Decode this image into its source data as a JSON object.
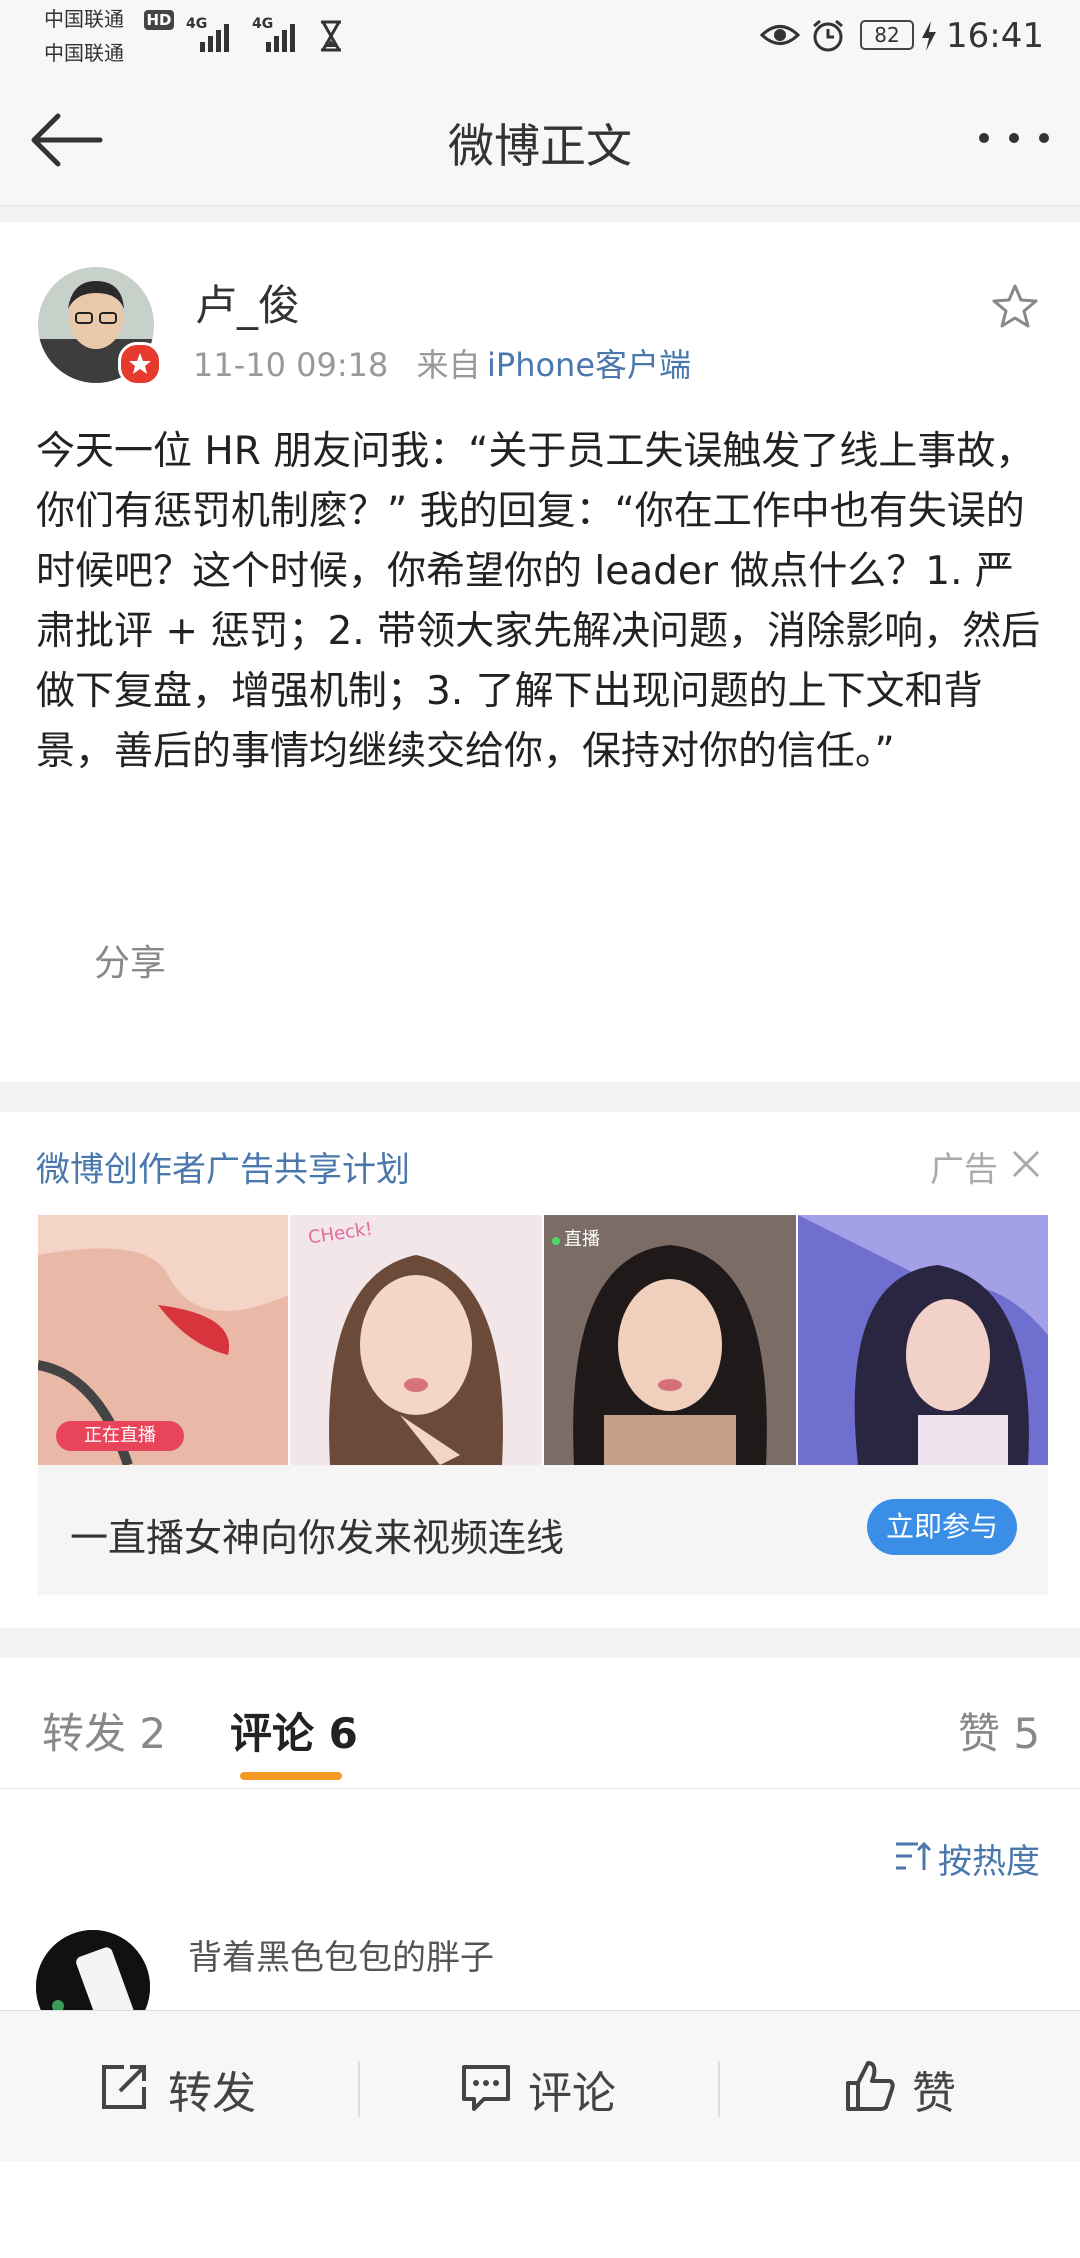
{
  "status_bar": {
    "carrier1": "中国联通",
    "carrier2": "中国联通",
    "hd": "HD",
    "net1": "4G",
    "net2": "4G",
    "battery": "82",
    "time": "16:41"
  },
  "navbar": {
    "title": "微博正文"
  },
  "post": {
    "author": "卢_俊",
    "time": "11-10 09:18",
    "source_prefix": "来自",
    "source": "iPhone客户端",
    "text": "今天一位 HR 朋友问我：“关于员工失误触发了线上事故，你们有惩罚机制麽？” 我的回复：“你在工作中也有失误的时候吧？这个时候，你希望你的 leader 做点什么？1. 严肃批评 + 惩罚；2. 带领大家先解决问题，消除影响，然后做下复盘，增强机制；3. 了解下出现问题的上下文和背景，善后的事情均继续交给你，保持对你的信任。”",
    "share_label": "分享",
    "share_icons": [
      "wechat-icon",
      "moments-icon",
      "qq-icon",
      "qzone-icon",
      "save-image-icon"
    ]
  },
  "ad": {
    "title": "微博创作者广告共享计划",
    "tag": "广告",
    "live_badge": "正在直播",
    "live_badge2": "直播",
    "check_text": "CHeck!",
    "footer_text": "一直播女神向你发来视频连线",
    "cta": "立即参与"
  },
  "tabs": {
    "repost": "转发 2",
    "comment": "评论 6",
    "like": "赞 5"
  },
  "comments": {
    "sort": "按热度",
    "first_name": "背着黑色包包的胖子"
  },
  "bottom_bar": {
    "repost": "转发",
    "comment": "评论",
    "like": "赞"
  },
  "colors": {
    "link": "#4a78ad",
    "accent": "#f59a23",
    "cta": "#3a8ee6",
    "wechat": "#35b64c",
    "moments": "#8cc63f",
    "qq": "#3fa7d6",
    "qzone": "#f5c400",
    "save": "#f0a020"
  }
}
